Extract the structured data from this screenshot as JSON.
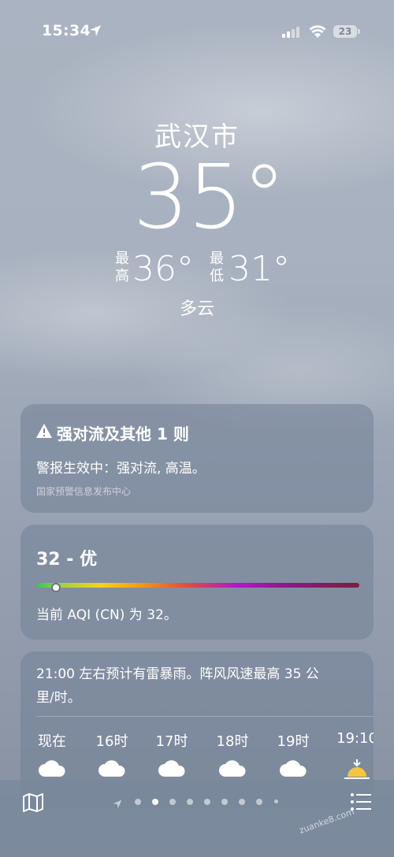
{
  "status_bar": {
    "time": "15:34",
    "battery_level": "23",
    "icons": [
      "location-arrow-icon",
      "cellular-signal-icon",
      "wifi-icon",
      "battery-icon"
    ]
  },
  "hero": {
    "city": "武汉市",
    "current_temp": "35°",
    "high_label": "最高",
    "high_value": "36°",
    "low_label": "最低",
    "low_value": "31°",
    "condition": "多云"
  },
  "alert_card": {
    "title": "强对流及其他 1 则",
    "body": "警报生效中：强对流, 高温。",
    "source": "国家预警信息发布中心",
    "icon": "warning-icon"
  },
  "aqi_card": {
    "value": "32 - 优",
    "description": "当前 AQI (CN) 为 32。",
    "level_fraction": 0.06
  },
  "hourly_card": {
    "description": "21:00 左右预计有雷暴雨。阵风风速最高 35 公里/时。",
    "hours": [
      {
        "label": "现在",
        "icon": "cloud-icon"
      },
      {
        "label": "16时",
        "icon": "cloud-icon"
      },
      {
        "label": "17时",
        "icon": "cloud-icon"
      },
      {
        "label": "18时",
        "icon": "cloud-icon"
      },
      {
        "label": "19时",
        "icon": "cloud-icon"
      },
      {
        "label": "19:10",
        "icon": "sunset-icon"
      }
    ]
  },
  "bottom_bar": {
    "icons": [
      "map-icon",
      "location-page-icon",
      "list-icon"
    ],
    "page_count": 9,
    "active_page": 2
  },
  "watermark": "zuanke8.com"
}
